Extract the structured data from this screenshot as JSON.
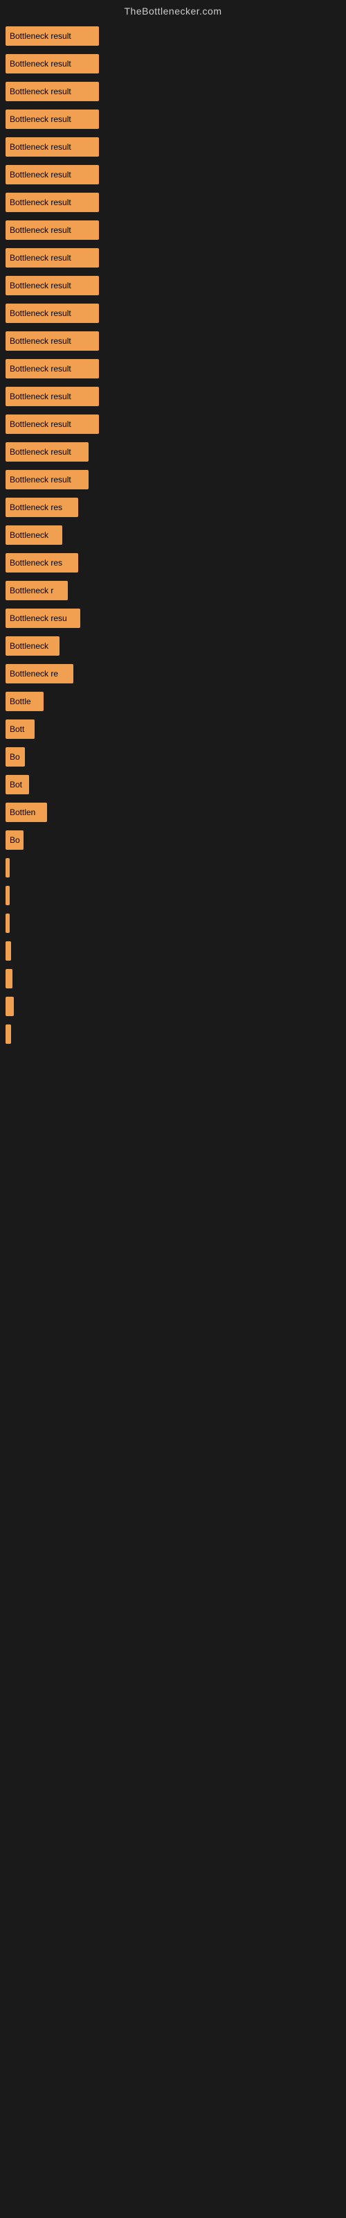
{
  "header": {
    "title": "TheBottlenecker.com"
  },
  "bars": [
    {
      "label": "Bottleneck result",
      "width": 135
    },
    {
      "label": "Bottleneck result",
      "width": 135
    },
    {
      "label": "Bottleneck result",
      "width": 135
    },
    {
      "label": "Bottleneck result",
      "width": 135
    },
    {
      "label": "Bottleneck result",
      "width": 135
    },
    {
      "label": "Bottleneck result",
      "width": 135
    },
    {
      "label": "Bottleneck result",
      "width": 135
    },
    {
      "label": "Bottleneck result",
      "width": 135
    },
    {
      "label": "Bottleneck result",
      "width": 135
    },
    {
      "label": "Bottleneck result",
      "width": 135
    },
    {
      "label": "Bottleneck result",
      "width": 135
    },
    {
      "label": "Bottleneck result",
      "width": 135
    },
    {
      "label": "Bottleneck result",
      "width": 135
    },
    {
      "label": "Bottleneck result",
      "width": 135
    },
    {
      "label": "Bottleneck result",
      "width": 135
    },
    {
      "label": "Bottleneck result",
      "width": 120
    },
    {
      "label": "Bottleneck result",
      "width": 120
    },
    {
      "label": "Bottleneck res",
      "width": 105
    },
    {
      "label": "Bottleneck",
      "width": 82
    },
    {
      "label": "Bottleneck res",
      "width": 105
    },
    {
      "label": "Bottleneck r",
      "width": 90
    },
    {
      "label": "Bottleneck resu",
      "width": 108
    },
    {
      "label": "Bottleneck",
      "width": 78
    },
    {
      "label": "Bottleneck re",
      "width": 98
    },
    {
      "label": "Bottle",
      "width": 55
    },
    {
      "label": "Bott",
      "width": 42
    },
    {
      "label": "Bo",
      "width": 28
    },
    {
      "label": "Bot",
      "width": 34
    },
    {
      "label": "Bottlen",
      "width": 60
    },
    {
      "label": "Bo",
      "width": 26
    },
    {
      "label": "",
      "width": 6
    },
    {
      "label": "",
      "width": 4
    },
    {
      "label": "",
      "width": 2
    },
    {
      "label": "",
      "width": 8
    },
    {
      "label": "",
      "width": 10
    },
    {
      "label": "",
      "width": 12
    },
    {
      "label": "",
      "width": 8
    }
  ]
}
